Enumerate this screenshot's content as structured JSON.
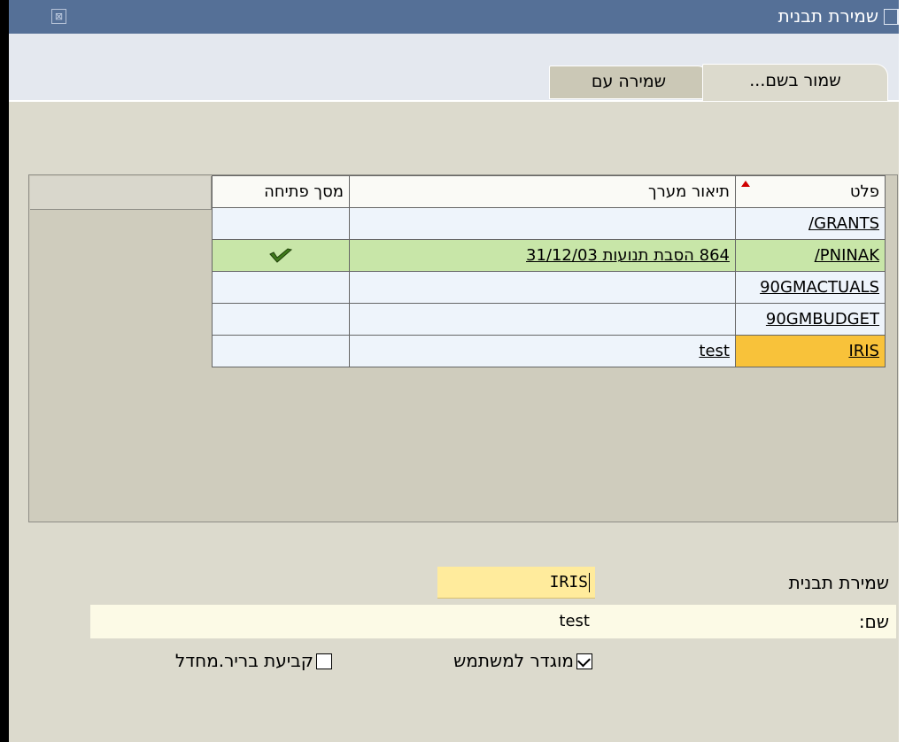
{
  "window": {
    "title": "שמירת תבנית",
    "close_symbol": "⊠"
  },
  "tabs": [
    {
      "label": "שמור בשם...",
      "active": true
    },
    {
      "label": "שמירה עם",
      "active": false
    }
  ],
  "grid": {
    "headers": {
      "layout": "פלט",
      "description": "תיאור מערך",
      "initial_screen": "מסך פתיחה"
    },
    "rows": [
      {
        "layout": "/GRANTS",
        "description": "",
        "initial": false
      },
      {
        "layout": "/PNINAK",
        "description": "864 הסבת תנועות 31/12/03",
        "initial": true
      },
      {
        "layout": "90GMACTUALS",
        "description": "",
        "initial": false
      },
      {
        "layout": "90GMBUDGET",
        "description": "",
        "initial": false
      },
      {
        "layout": "IRIS",
        "description": "test",
        "initial": false
      }
    ],
    "colors": {
      "highlight_row": "#c8e6a8",
      "selected_cell": "#f8c23a",
      "sort_marker": "#d00000"
    }
  },
  "form": {
    "layout_label": "שמירת תבנית",
    "layout_value": "IRIS",
    "name_label": "שם:",
    "name_value": "test",
    "user_specific_label": "מוגדר למשתמש",
    "user_specific_checked": true,
    "default_label": "קביעת בריר.מחדל",
    "default_checked": false
  }
}
